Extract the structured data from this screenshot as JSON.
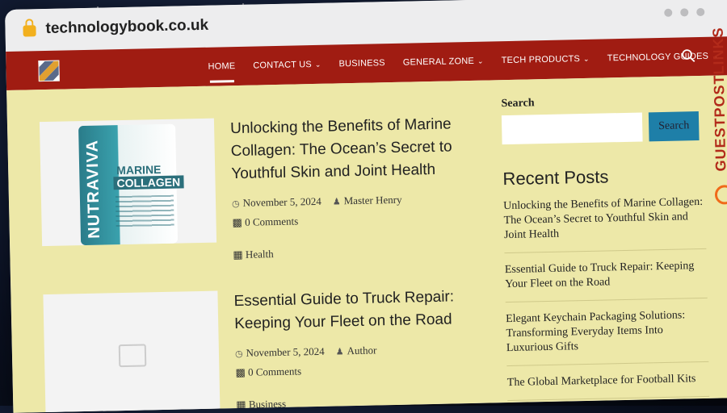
{
  "browser": {
    "url": "technologybook.co.uk"
  },
  "nav": {
    "items": [
      {
        "label": "HOME",
        "active": true,
        "dropdown": false
      },
      {
        "label": "CONTACT US",
        "active": false,
        "dropdown": true
      },
      {
        "label": "BUSINESS",
        "active": false,
        "dropdown": false
      },
      {
        "label": "GENERAL ZONE",
        "active": false,
        "dropdown": true
      },
      {
        "label": "TECH PRODUCTS",
        "active": false,
        "dropdown": true
      },
      {
        "label": "TECHNOLOGY GUIDES",
        "active": false,
        "dropdown": true
      }
    ],
    "search_icon": "search-icon"
  },
  "posts": [
    {
      "title": "Unlocking the Benefits of Marine Collagen: The Ocean’s Secret to Youthful Skin and Joint Health",
      "date": "November 5, 2024",
      "author": "Master Henry",
      "comments": "0 Comments",
      "category": "Health",
      "image": {
        "brand": "NUTRAVIVA",
        "line1": "MARINE",
        "line2": "COLLAGEN"
      }
    },
    {
      "title": "Essential Guide to Truck Repair: Keeping Your Fleet on the Road",
      "date": "November 5, 2024",
      "author": "Author",
      "comments": "0 Comments",
      "category": "Business"
    }
  ],
  "sidebar": {
    "search_label": "Search",
    "search_button": "Search",
    "search_placeholder": "",
    "recent_heading": "Recent Posts",
    "recent_posts": [
      "Unlocking the Benefits of Marine Collagen: The Ocean’s Secret to Youthful Skin and Joint Health",
      "Essential Guide to Truck Repair: Keeping Your Fleet on the Road",
      "Elegant Keychain Packaging Solutions: Transforming Everyday Items Into Luxurious Gifts",
      "The Global Marketplace for Football Kits"
    ]
  },
  "badge": {
    "text": "GUESTPOSTLINKS"
  },
  "colors": {
    "nav": "#a01c12",
    "content_bg": "#ede8a8",
    "search_button": "#1e7fa8",
    "badge": "#b22a1a"
  }
}
